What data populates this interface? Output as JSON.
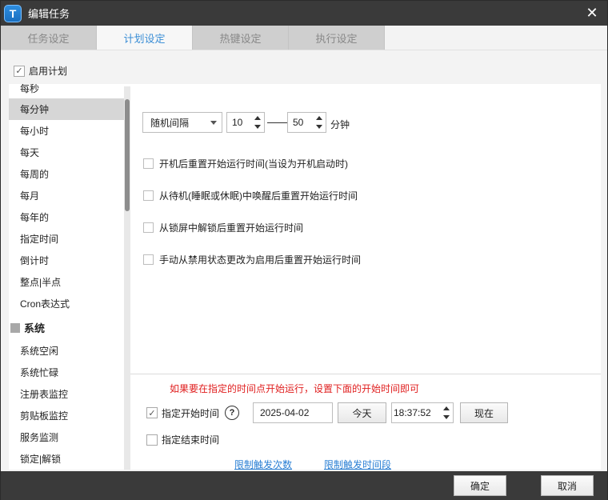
{
  "window": {
    "title": "编辑任务",
    "app_icon_letter": "T",
    "close_label": "✕"
  },
  "tabs": [
    {
      "label": "任务设定",
      "active": false
    },
    {
      "label": "计划设定",
      "active": true
    },
    {
      "label": "热键设定",
      "active": false
    },
    {
      "label": "执行设定",
      "active": false
    }
  ],
  "enable_plan": {
    "label": "启用计划",
    "checked": true,
    "check_glyph": "✓"
  },
  "schedule_list": {
    "items": [
      "每秒",
      "每分钟",
      "每小时",
      "每天",
      "每周的",
      "每月",
      "每年的",
      "指定时间",
      "倒计时",
      "整点|半点",
      "Cron表达式"
    ],
    "selected": "每分钟",
    "group": "系统",
    "group_items": [
      "系统空闲",
      "系统忙碌",
      "注册表监控",
      "剪贴板监控",
      "服务监测",
      "锁定|解锁"
    ]
  },
  "interval": {
    "mode": "随机间隔",
    "min": "10",
    "max": "50",
    "unit": "分钟"
  },
  "options": [
    "开机后重置开始运行时间(当设为开机启动时)",
    "从待机(睡眠或休眠)中唤醒后重置开始运行时间",
    "从锁屏中解锁后重置开始运行时间",
    "手动从禁用状态更改为启用后重置开始运行时间"
  ],
  "start": {
    "hint": "如果要在指定的时间点开始运行，设置下面的开始时间即可",
    "label": "指定开始时间",
    "checked": true,
    "check_glyph": "✓",
    "help_glyph": "?",
    "date": "2025-04-02",
    "today_label": "今天",
    "time": "18:37:52",
    "now_label": "现在"
  },
  "end": {
    "label": "指定结束时间",
    "checked": false
  },
  "links": {
    "limit_count": "限制触发次数",
    "limit_period": "限制触发时间段"
  },
  "footer": {
    "ok_label": "确定",
    "cancel_label": "取消"
  },
  "colors": {
    "accent": "#3c8fd6",
    "hint": "#e02020",
    "link": "#2a7fd4",
    "titlebar": "#3a3a3a"
  }
}
